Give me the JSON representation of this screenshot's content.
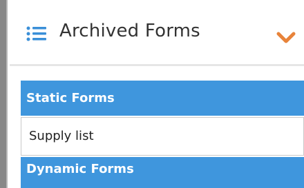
{
  "header": {
    "title": "Archived Forms",
    "list_icon": "list-icon",
    "collapse_icon": "chevron-down-icon",
    "accent_color": "#e8833a"
  },
  "sections": [
    {
      "label": "Static Forms",
      "items": [
        "Supply list"
      ]
    },
    {
      "label": "Dynamic Forms",
      "items": []
    }
  ],
  "colors": {
    "section_header_bg": "#3f96dd",
    "section_header_text": "#ffffff"
  }
}
